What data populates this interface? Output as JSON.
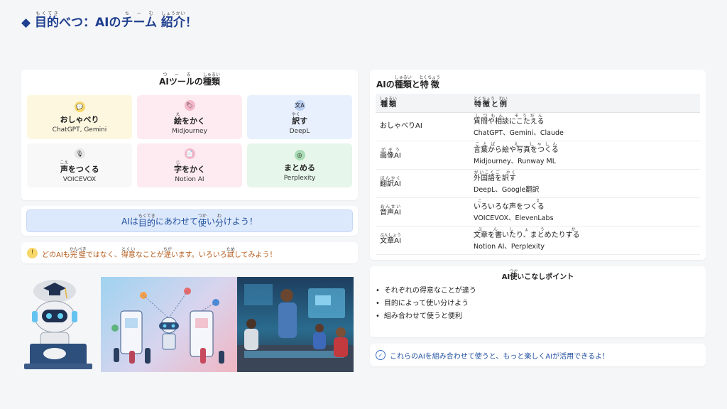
{
  "header": {
    "marker": "◆",
    "title_a": "目的",
    "title_a_rt": "もくてき",
    "title_b": "べつ：AIの",
    "title_c": "チーム",
    "title_c_rt": "ちーむ",
    "title_d": "紹介",
    "title_d_rt": "しょうかい",
    "title_e": "！"
  },
  "tools": {
    "title_a": "AIツール",
    "title_a_rt": "つーる",
    "title_b": "の",
    "title_c": "種類",
    "title_c_rt": "しゅるい",
    "items": [
      {
        "icon": "💬",
        "name_pre": "",
        "name_kanji": "",
        "name_rt": "",
        "name_post": "おしゃべり",
        "example": "ChatGPT, Gemini"
      },
      {
        "icon": "🏷",
        "name_pre": "",
        "name_kanji": "絵",
        "name_rt": "え",
        "name_post": "をかく",
        "example": "Midjourney"
      },
      {
        "icon": "文A",
        "name_pre": "",
        "name_kanji": "訳",
        "name_rt": "やく",
        "name_post": "す",
        "example": "DeepL"
      },
      {
        "icon": "🎙",
        "name_pre": "",
        "name_kanji": "声",
        "name_rt": "こえ",
        "name_post": "をつくる",
        "example": "VOICEVOX"
      },
      {
        "icon": "📄",
        "name_pre": "",
        "name_kanji": "字",
        "name_rt": "じ",
        "name_post": "をかく",
        "example": "Notion AI"
      },
      {
        "icon": "◎",
        "name_pre": "",
        "name_kanji": "",
        "name_rt": "",
        "name_post": "まとめる",
        "example": "Perplexity"
      }
    ]
  },
  "banner": {
    "a": "AIは",
    "b": "目的",
    "b_rt": "もくてき",
    "c": "にあわせて",
    "d": "使",
    "d_rt": "つか",
    "e": "い",
    "f": "分",
    "f_rt": "わ",
    "g": "けよう！"
  },
  "tip": {
    "icon": "!",
    "a": "どのAIも",
    "b": "完璧",
    "b_rt": "かんぺき",
    "c": "ではなく、",
    "d": "得意",
    "d_rt": "とくい",
    "e": "なことが",
    "f": "違",
    "f_rt": "ちが",
    "g": "います。いろいろ",
    "h": "試",
    "h_rt": "ため",
    "i": "してみよう！"
  },
  "types": {
    "title_a": "AIの",
    "title_b": "種類",
    "title_b_rt": "しゅるい",
    "title_c": "と",
    "title_d": "特徴",
    "title_d_rt": "とくちょう",
    "header_col1": "種類",
    "header_col1_rt": "しゅるい",
    "header_col2": "特徴と例",
    "header_col2_rt": "とくちょう　れい",
    "rows": [
      {
        "type": "おしゃべりAI",
        "type_rt": "",
        "feature": "質問や相談にこたえる",
        "feature_rt": "しつもん　そうだん",
        "example": "ChatGPT、Gemini、Claude"
      },
      {
        "type": "画像AI",
        "type_rt": "がぞう",
        "feature": "言葉から絵や写真をつくる",
        "feature_rt": "ことば　　え　しゃしん",
        "example": "Midjourney、Runway ML"
      },
      {
        "type": "翻訳AI",
        "type_rt": "ほんやく",
        "feature": "外国語を訳す",
        "feature_rt": "がいこくご　やく",
        "example": "DeepL、Google翻訳"
      },
      {
        "type": "音声AI",
        "type_rt": "おんせい",
        "feature": "いろいろな声をつくる",
        "feature_rt": "こえ",
        "example": "VOICEVOX、ElevenLabs"
      },
      {
        "type": "文章AI",
        "type_rt": "ぶんしょう",
        "feature": "文章を書いたり、まとめたりする",
        "feature_rt": "ぶんしょう　か",
        "example": "Notion AI、Perplexity"
      }
    ]
  },
  "points": {
    "title_a": "AI",
    "title_b": "使",
    "title_b_rt": "つか",
    "title_c": "いこなしポイント",
    "items": [
      "それぞれの得意なことが違う",
      "目的によって使い分けよう",
      "組み合わせて使うと便利"
    ]
  },
  "closing": {
    "icon": "✓",
    "text": "これらのAIを組み合わせて使うと、もっと楽しくAIが活用できるよ！"
  },
  "colors": {
    "title": "#1f3f8f",
    "banner_text": "#1f4fa0",
    "tip_text": "#b25a1a"
  }
}
